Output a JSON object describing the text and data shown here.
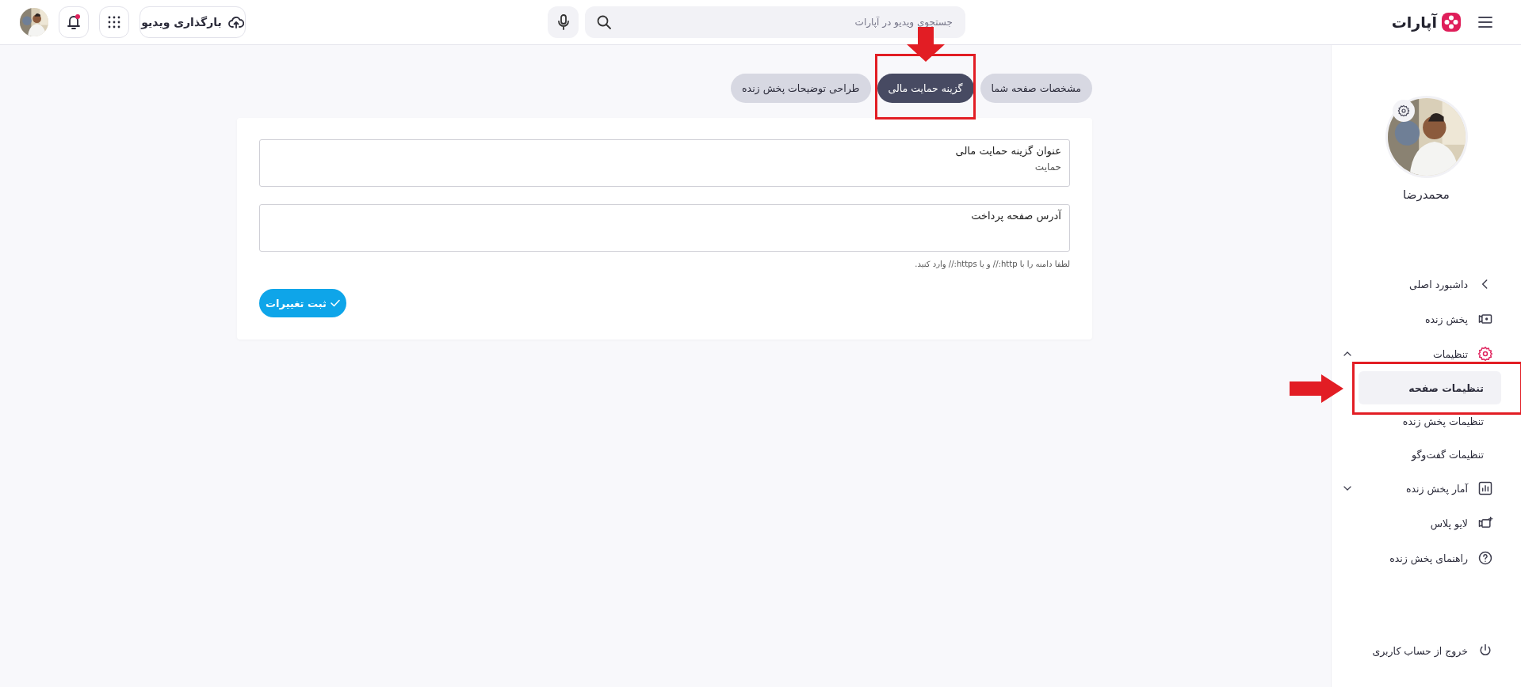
{
  "header": {
    "logo": "آپارات",
    "search": {
      "placeholder": "جستجوی ویدیو در آپارات"
    },
    "upload_button": "بارگذاری ویدیو",
    "notifications": {
      "unread": true
    }
  },
  "tabs": [
    {
      "label": "مشخصات صفحه شما",
      "selected": false,
      "annotated": false
    },
    {
      "label": "گزینه حمایت مالی",
      "selected": true,
      "annotated": true
    },
    {
      "label": "طراحی توضیحات پخش زنده",
      "selected": false,
      "annotated": false
    }
  ],
  "form": {
    "fields": [
      {
        "label": "عنوان گزینه حمایت مالی",
        "value": "حمایت"
      },
      {
        "label": "آدرس صفحه پرداخت"
      }
    ],
    "help": "لطفا دامنه را با http:// و یا https:// وارد کنید.",
    "submit": "ثبت تغییرات"
  },
  "sidebar": {
    "user": {
      "name": "محمدرضا"
    },
    "items": [
      {
        "label": "داشبورد اصلی",
        "kind": "link",
        "selected": false
      },
      {
        "label": "پخش زنده",
        "kind": "link",
        "selected": false
      },
      {
        "label": "تنظیمات",
        "kind": "group",
        "selected": true,
        "expanded": true,
        "children": [
          {
            "label": "تنظیمات صفحه",
            "selected": true,
            "annotated": true
          },
          {
            "label": "تنظیمات پخش زنده",
            "selected": false,
            "annotated": false
          },
          {
            "label": "تنظیمات گفت‌وگو",
            "selected": false,
            "annotated": false
          }
        ]
      },
      {
        "label": "آمار پخش زنده",
        "kind": "group",
        "selected": false,
        "expanded": false
      },
      {
        "label": "لایو پلاس",
        "kind": "link",
        "selected": false
      },
      {
        "label": "راهنمای پخش زنده",
        "kind": "link",
        "selected": false
      }
    ],
    "logout": "خروج از حساب کاربری"
  }
}
